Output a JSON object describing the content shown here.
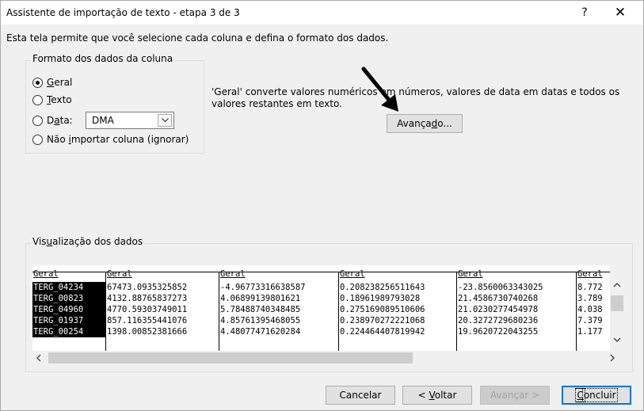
{
  "window": {
    "title": "Assistente de importação de texto - etapa 3 de 3",
    "help": "?",
    "close": "✕"
  },
  "intro": "Esta tela permite que você selecione cada coluna e defina o formato dos dados.",
  "format_group": {
    "legend": "Formato dos dados da coluna",
    "options": [
      {
        "pre": "",
        "key": "G",
        "post": "eral",
        "checked": true
      },
      {
        "pre": "",
        "key": "T",
        "post": "exto",
        "checked": false
      },
      {
        "pre": "D",
        "key": "a",
        "post": "ta:",
        "checked": false
      },
      {
        "pre": "Não ",
        "key": "i",
        "post": "mportar coluna (ignorar)",
        "checked": false
      }
    ],
    "date_format": "DMA"
  },
  "description": "'Geral' converte valores numéricos em números, valores de data em datas e todos os valores restantes em texto.",
  "advanced_button": {
    "pre": "Avança",
    "key": "d",
    "post": "o..."
  },
  "preview": {
    "label_pre": "Vis",
    "label_key": "u",
    "label_post": "alização dos dados",
    "headers": [
      "Geral",
      "Geral",
      "Geral",
      "Geral",
      "Geral",
      "Geral"
    ],
    "rows": [
      [
        "TERG_04234",
        "67473.0935325852",
        "-4.96773316638587",
        "0.208238256511643",
        "-23.8560063343025",
        "8.772"
      ],
      [
        "TERG_00823",
        "4132.88765837273",
        "4.06899139801621",
        "0.18961989793028",
        "21.4586730740268",
        "3.789"
      ],
      [
        "TERG_04960",
        "4770.59303749011",
        "5.78488740348485",
        "0.275169089510606",
        "21.0230277454978",
        "4.038"
      ],
      [
        "TERG_01937",
        "857.116355441076",
        "4.85761395468055",
        "0.238970272221068",
        "20.3272729680236",
        "7.379"
      ],
      [
        "TERG_00254",
        "1398.00852381666",
        "4.48077471620284",
        "0.224464407819942",
        "19.9620722043255",
        "1.177"
      ]
    ]
  },
  "buttons": {
    "cancel": "Cancelar",
    "back_pre": "< ",
    "back_key": "V",
    "back_post": "oltar",
    "next": "Avançar >",
    "finish_key": "C",
    "finish_post": "oncluir"
  },
  "colors": {
    "selected_column_bg": "#000000",
    "finish_border": "#0078d7"
  }
}
